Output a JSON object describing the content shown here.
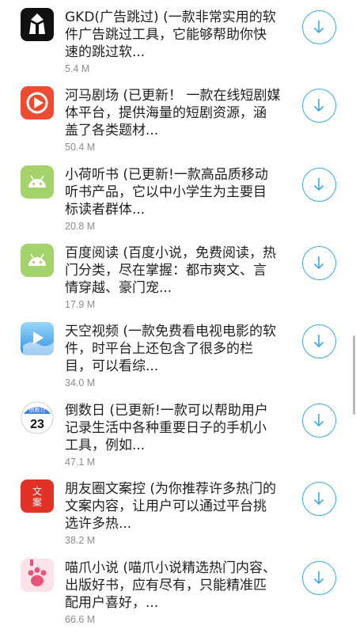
{
  "apps": [
    {
      "desc": "GKD(广告跳过) (一款非常实用的软\n件广告跳过工具，它能够帮助你快\n速的跳过软...",
      "size": "5.4 M",
      "icon": "gkd-icon"
    },
    {
      "desc": "河马剧场 (已更新！ 一款在线短剧媒\n体平台，提供海量的短剧资源，涵\n盖了各类题材...",
      "size": "50.4 M",
      "icon": "hema-juchang-icon"
    },
    {
      "desc": "小荷听书 (已更新!一款高品质移动\n听书产品，它以中小学生为主要目\n标读者群体...",
      "size": "20.8 M",
      "icon": "android-icon"
    },
    {
      "desc": "百度阅读 (百度小说，免费阅读，热\n门分类，尽在掌握：都市爽文、言\n情穿越、豪门宠...",
      "size": "17.9 M",
      "icon": "android-icon"
    },
    {
      "desc": "天空视频 (一款免费看电视电影的软\n件，时平台上还包含了很多的栏\n目，可以看综...",
      "size": "34.0 M",
      "icon": "video-play-icon"
    },
    {
      "desc": "倒数日 (已更新!一款可以帮助用户\n记录生活中各种重要日子的手机小\n工具，例如...",
      "size": "47.1 M",
      "icon": "calendar-icon",
      "icon_text": {
        "top": "倒数日",
        "day": "23"
      }
    },
    {
      "desc": "朋友圈文案控 (为你推荐许多热门的\n文案内容，让用户可以通过平台挑\n选许多热...",
      "size": "38.2 M",
      "icon": "wenan-icon",
      "icon_text": {
        "top": "文",
        "bottom": "案"
      }
    },
    {
      "desc": "喵爪小说 (喵爪小说精选热门内容、\n出版好书，应有尽有，只能精准匹\n配用户喜好，...",
      "size": "66.6 M",
      "icon": "paw-icon"
    }
  ],
  "colors": {
    "accent": "#3aa9e6",
    "size_text": "#8c8c8c",
    "android_green": "#a4d36b",
    "hema_red": "#ee4b32",
    "wenan_red": "#e23227"
  }
}
